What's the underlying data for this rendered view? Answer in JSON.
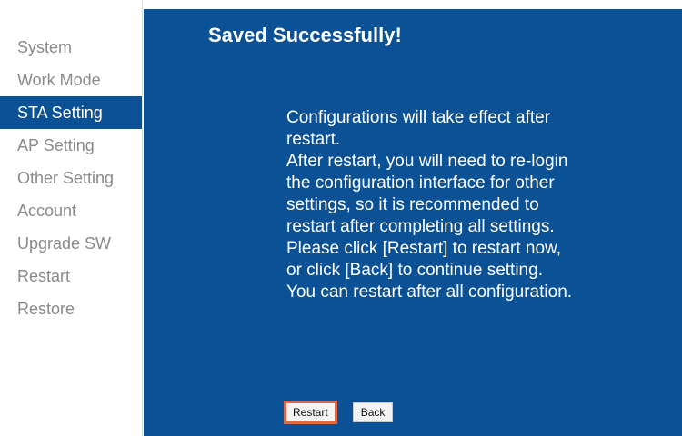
{
  "sidebar": {
    "items": [
      {
        "label": "System",
        "active": false
      },
      {
        "label": "Work Mode",
        "active": false
      },
      {
        "label": "STA Setting",
        "active": true
      },
      {
        "label": "AP Setting",
        "active": false
      },
      {
        "label": "Other Setting",
        "active": false
      },
      {
        "label": "Account",
        "active": false
      },
      {
        "label": "Upgrade SW",
        "active": false
      },
      {
        "label": "Restart",
        "active": false
      },
      {
        "label": "Restore",
        "active": false
      }
    ]
  },
  "main": {
    "title": "Saved Successfully!",
    "message_lines": [
      "Configurations will take effect after",
      "restart.",
      "After restart, you will need to re-login",
      "the configuration interface for other",
      "settings, so it is recommended to",
      "restart after completing all settings.",
      "Please click [Restart] to restart now,",
      "or click [Back] to continue setting.",
      "You can restart after all configuration."
    ],
    "buttons": {
      "restart_label": "Restart",
      "back_label": "Back"
    }
  },
  "colors": {
    "panel_background": "#0b5196",
    "active_nav_background": "#0b5196",
    "nav_text": "#8a8a8a",
    "restart_button_border": "#d96b4c"
  }
}
